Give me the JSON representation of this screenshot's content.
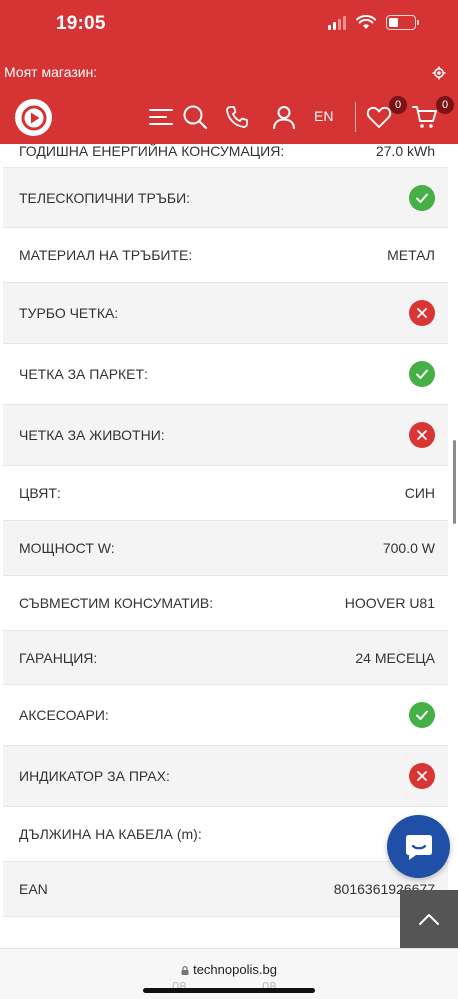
{
  "status": {
    "time": "19:05"
  },
  "store": {
    "label": "Моят магазин:"
  },
  "header": {
    "lang": "EN",
    "wishlist_count": "0",
    "cart_count": "0"
  },
  "specs": {
    "partial": {
      "label": "ГОДИШНА ЕНЕРГИЙНА КОНСУМАЦИЯ:",
      "value": "27.0 kWh"
    },
    "rows": [
      {
        "label": "ТЕЛЕСКОПИЧНИ ТРЪБИ:",
        "value": "",
        "mark": "yes"
      },
      {
        "label": "МАТЕРИАЛ НА ТРЪБИТЕ:",
        "value": "МЕТАЛ",
        "mark": ""
      },
      {
        "label": "ТУРБО ЧЕТКА:",
        "value": "",
        "mark": "no"
      },
      {
        "label": "ЧЕТКА ЗА ПАРКЕТ:",
        "value": "",
        "mark": "yes"
      },
      {
        "label": "ЧЕТКА ЗА ЖИВОТНИ:",
        "value": "",
        "mark": "no"
      },
      {
        "label": "ЦВЯТ:",
        "value": "СИН",
        "mark": ""
      },
      {
        "label": "МОЩНОСТ W:",
        "value": "700.0 W",
        "mark": ""
      },
      {
        "label": "СЪВМЕСТИМ КОНСУМАТИВ:",
        "value": "HOOVER U81",
        "mark": ""
      },
      {
        "label": "ГАРАНЦИЯ:",
        "value": "24 МЕСЕЦА",
        "mark": ""
      },
      {
        "label": "АКСЕСОАРИ:",
        "value": "",
        "mark": "yes"
      },
      {
        "label": "ИНДИКАТОР ЗА ПРАХ:",
        "value": "",
        "mark": "no"
      },
      {
        "label": "ДЪЛЖИНА НА КАБЕЛА (m):",
        "value": "",
        "mark": ""
      },
      {
        "label": "EAN",
        "value": "8016361926677",
        "mark": ""
      }
    ]
  },
  "browser": {
    "url": "technopolis.bg",
    "ghost_left": "08",
    "ghost_right": "08"
  },
  "colors": {
    "brand": "#d63334",
    "ok": "#44b046",
    "no": "#d93535",
    "chat": "#1f4fa6"
  },
  "icons": {
    "logo": "play-logo-icon",
    "menu": "menu-icon",
    "search": "search-icon",
    "phone": "phone-icon",
    "user": "user-icon",
    "wishlist": "heart-icon",
    "cart": "cart-icon",
    "yes": "check-circle-icon",
    "no": "x-circle-icon",
    "chat": "chat-icon",
    "top": "chevron-up-icon"
  }
}
